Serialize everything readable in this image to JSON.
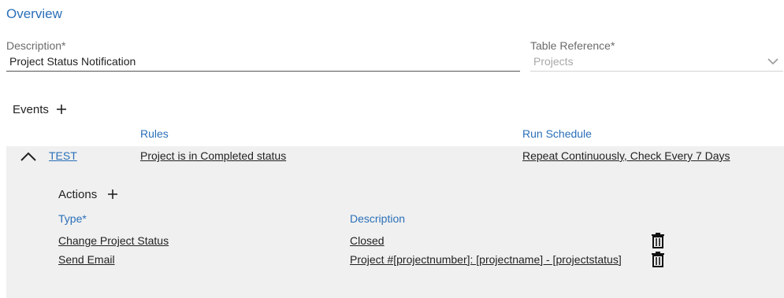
{
  "section": {
    "title": "Overview"
  },
  "form": {
    "description_label": "Description*",
    "description_value": "Project Status Notification",
    "table_reference_label": "Table Reference*",
    "table_reference_value": "Projects"
  },
  "events": {
    "title": "Events",
    "columns": {
      "rules": "Rules",
      "run_schedule": "Run Schedule"
    },
    "items": [
      {
        "name": "TEST",
        "rule": "Project is in Completed status",
        "schedule": "Repeat Continuously, Check Every 7 Days",
        "expanded": true,
        "actions": {
          "title": "Actions",
          "columns": {
            "type": "Type*",
            "description": "Description"
          },
          "rows": [
            {
              "type": "Change Project Status",
              "description": "Closed"
            },
            {
              "type": "Send Email",
              "description": "Project #[projectnumber]: [projectname] - [projectstatus]"
            }
          ]
        }
      }
    ]
  },
  "colors": {
    "accent": "#2a6fb8",
    "panel_bg": "#f0f0f0"
  },
  "icons": {
    "add": "plus-icon",
    "collapse": "chevron-up-icon",
    "dropdown": "chevron-down-icon",
    "delete": "trash-icon"
  }
}
